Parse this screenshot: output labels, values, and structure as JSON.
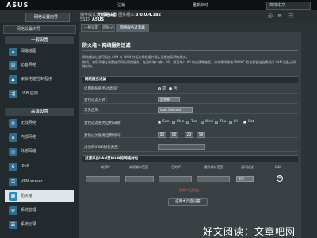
{
  "header": {
    "logo": "ASUS",
    "logout_label": "注销",
    "reboot_label": "重新启动",
    "language": "简体中文"
  },
  "status": {
    "setup_label": "网络设置向导",
    "op_mode_label": "操作模式:",
    "op_mode_value": "无线路由器",
    "firmware_label": "固件版本:",
    "firmware_value": "3.0.0.4.382",
    "ssid_label": "SSID:",
    "ssid_value": "ASUS"
  },
  "sidebar": {
    "general_title": "一般设置",
    "general_items": [
      {
        "label": "网络地图",
        "icon": "network-map-icon"
      },
      {
        "label": "访客网络",
        "icon": "guest-network-icon"
      },
      {
        "label": "家长电脑控制程序",
        "icon": "parental-control-icon"
      },
      {
        "label": "USB 应用",
        "icon": "usb-icon"
      }
    ],
    "advanced_title": "高级设置",
    "advanced_items": [
      {
        "label": "无线网络",
        "icon": "wireless-icon"
      },
      {
        "label": "内部网络",
        "icon": "lan-icon"
      },
      {
        "label": "外部网络",
        "icon": "wan-icon"
      },
      {
        "label": "IPv6",
        "icon": "ipv6-icon"
      },
      {
        "label": "VPN server",
        "icon": "vpn-icon"
      },
      {
        "label": "防火墙",
        "icon": "firewall-icon"
      },
      {
        "label": "系统管理",
        "icon": "administration-icon"
      },
      {
        "label": "系统记录",
        "icon": "system-log-icon"
      }
    ],
    "active_index": 5
  },
  "tabs": [
    "一般设置",
    "网址过滤",
    "网络服务过滤器"
  ],
  "page": {
    "title": "防火墙 - 网络服务过滤",
    "desc_lines": [
      "网络服务过滤可阻止 LAN 对 WAN 分组交换数据并限定设备使用网络服务。",
      "例如，若您不想让装置使用网际网路服务，在目标端口输入 80。网页端口 80 的交通将被阻。请勿将网路端 IP/MAC 栏位保留空白将关闭 LAN 设备上网路封包。"
    ],
    "section_title": "网络服务过滤",
    "enable_label": "启用网络服务过滤吗？",
    "enable_yes": "是",
    "enable_no": "否",
    "filter_table_label": "封包过滤方式：",
    "filter_table_value": "黑名单",
    "well_known_label": "常见应用：",
    "well_known_value": "User Defined",
    "date_label": "封包过滤服务启用日期：",
    "days": [
      "Sun",
      "Mon",
      "Tue",
      "Wed",
      "Thu",
      "Fri",
      "Sat"
    ],
    "days_checked": [
      false,
      true,
      true,
      true,
      true,
      true,
      false
    ],
    "time_label": "封包过滤服务启用时间：",
    "time_from": [
      "00",
      "00"
    ],
    "time_to": [
      "23",
      "59"
    ],
    "icmp_label": "过滤的ICMP封包类型：",
    "table_title": "过滤来自LAN至WAN的网络封包",
    "columns": [
      "来源IP",
      "来源端口范围",
      "目的IP",
      "通讯端口范围",
      "通讯协议",
      "Edit"
    ],
    "protocol_value": "TCP",
    "no_data": "表格中无数据。",
    "apply_label": "应用本页面设置"
  },
  "watermark": "好文阅读：文章吧网"
}
